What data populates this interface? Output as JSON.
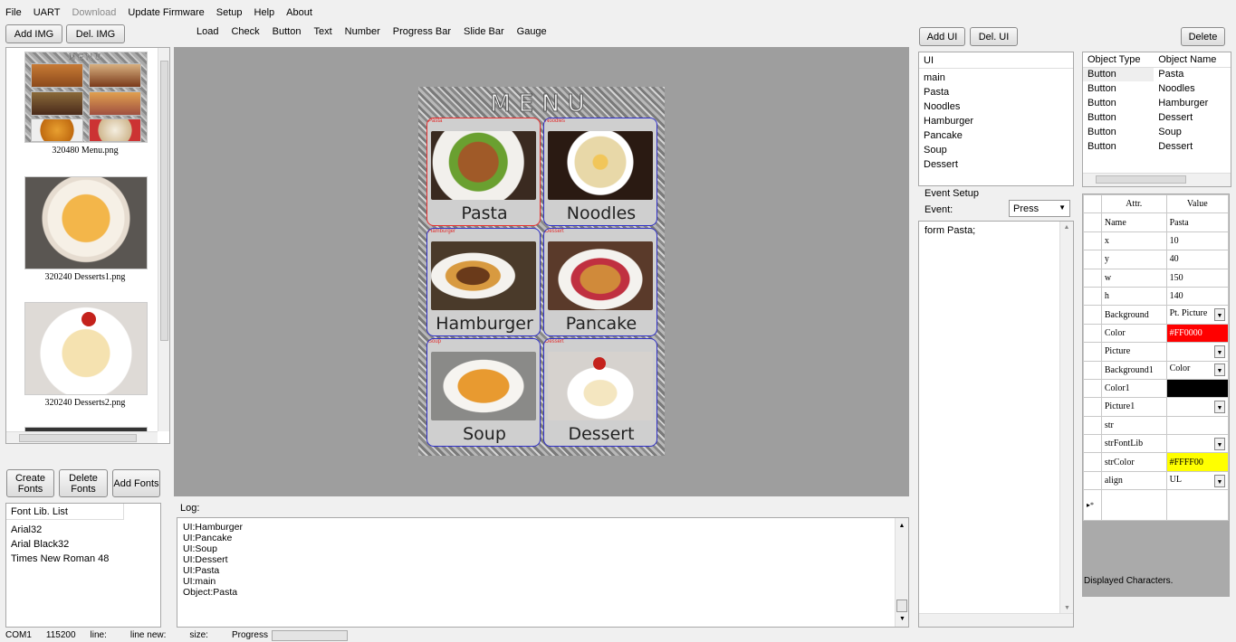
{
  "menu": [
    "File",
    "UART",
    "Download",
    "Update Firmware",
    "Setup",
    "Help",
    "About"
  ],
  "buttons": {
    "add_img": "Add IMG",
    "del_img": "Del. IMG",
    "add_ui": "Add UI",
    "del_ui": "Del. UI",
    "delete": "Delete",
    "create_fonts": "Create Fonts",
    "delete_fonts": "Delete Fonts",
    "add_fonts": "Add Fonts"
  },
  "tools": [
    "Load",
    "Check",
    "Button",
    "Text",
    "Number",
    "Progress Bar",
    "Slide Bar",
    "Gauge"
  ],
  "images": [
    "320480 Menu.png",
    "320240 Desserts1.png",
    "320240 Desserts2.png"
  ],
  "preview": {
    "title": "MENU",
    "thumb_title": "MENU",
    "cells": [
      {
        "tag": "Pasta",
        "label": "Pasta"
      },
      {
        "tag": "Noodles",
        "label": "Noodles"
      },
      {
        "tag": "Hamburger",
        "label": "Hamburger"
      },
      {
        "tag": "Dessert",
        "label": "Pancake"
      },
      {
        "tag": "Soup",
        "label": "Soup"
      },
      {
        "tag": "Dessert",
        "label": "Dessert"
      }
    ]
  },
  "log": {
    "label": "Log:",
    "lines": [
      "UI:Hamburger",
      "UI:Pancake",
      "UI:Soup",
      "UI:Dessert",
      "UI:Pasta",
      "UI:main",
      "Object:Pasta"
    ]
  },
  "ui_list": {
    "header": "UI",
    "items": [
      "main",
      "Pasta",
      "Noodles",
      "Hamburger",
      "Pancake",
      "Soup",
      "Dessert"
    ]
  },
  "objects": {
    "headers": [
      "Object Type",
      "Object Name"
    ],
    "rows": [
      [
        "Button",
        "Pasta"
      ],
      [
        "Button",
        "Noodles"
      ],
      [
        "Button",
        "Hamburger"
      ],
      [
        "Button",
        "Dessert"
      ],
      [
        "Button",
        "Soup"
      ],
      [
        "Button",
        "Dessert"
      ]
    ]
  },
  "event": {
    "section": "Event Setup",
    "label": "Event:",
    "value": "Press",
    "code": "form Pasta;"
  },
  "attributes": {
    "headers": [
      "Attr.",
      "Value"
    ],
    "rows": [
      [
        "Name",
        "Pasta"
      ],
      [
        "x",
        "10"
      ],
      [
        "y",
        "40"
      ],
      [
        "w",
        "150"
      ],
      [
        "h",
        "140"
      ],
      [
        "Background",
        "Pt. Picture"
      ],
      [
        "Color",
        "#FF0000"
      ],
      [
        "Picture",
        ""
      ],
      [
        "Background1",
        "Color"
      ],
      [
        "Color1",
        ""
      ],
      [
        "Picture1",
        ""
      ],
      [
        "str",
        ""
      ],
      [
        "strFontLib",
        ""
      ],
      [
        "strColor",
        "#FFFF00"
      ],
      [
        "align",
        "UL"
      ]
    ],
    "new_row_marker": "▸*",
    "swatches": {
      "Color": "#ff0000",
      "Color1": "#000000",
      "strColor": "#ffff00"
    }
  },
  "displayed_chars": "Displayed Characters.",
  "fonts": {
    "header": "Font Lib. List",
    "items": [
      "Arial32",
      "Arial Black32",
      "Times New Roman 48"
    ]
  },
  "status": [
    "COM1",
    "115200",
    "line:",
    "line new:",
    "size:",
    "Progress"
  ]
}
